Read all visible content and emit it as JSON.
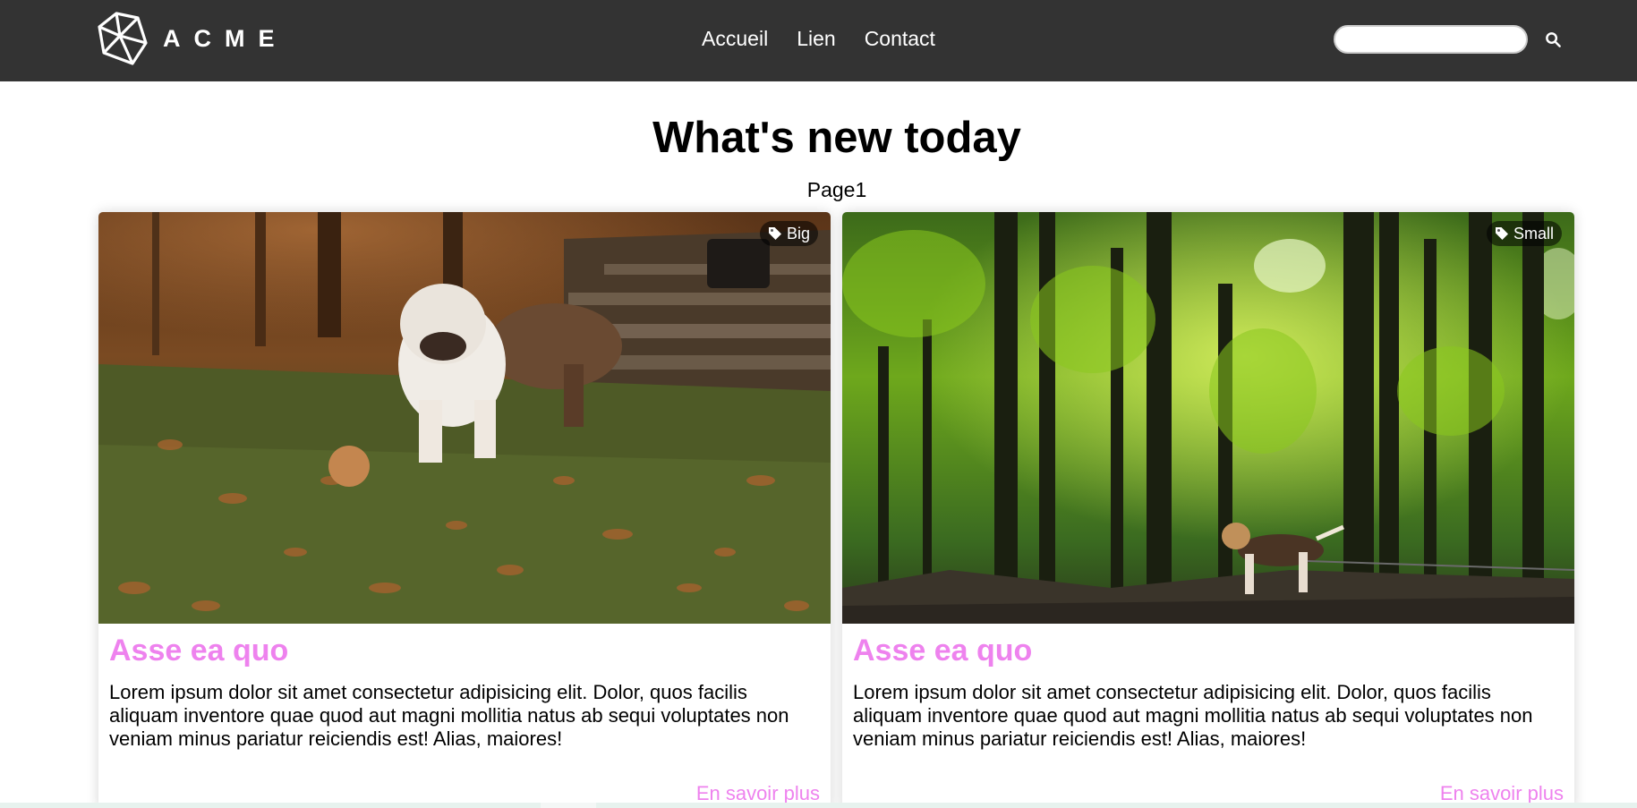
{
  "brand": {
    "name": "ACME",
    "logo_icon": "polyhedron-logo-icon"
  },
  "nav": {
    "items": [
      {
        "label": "Accueil"
      },
      {
        "label": "Lien"
      },
      {
        "label": "Contact"
      }
    ]
  },
  "search": {
    "value": "",
    "placeholder": "",
    "icon": "search-icon"
  },
  "main": {
    "title": "What's new today",
    "subtitle": "Page1"
  },
  "cards": [
    {
      "tag": "Big",
      "tag_icon": "tag-icon",
      "image": "bulldog-autumn-leaves-photo",
      "title": "Asse ea quo",
      "text": "Lorem ipsum dolor sit amet consectetur adipisicing elit. Dolor, quos facilis aliquam inventore quae quod aut magni mollitia natus ab sequi voluptates non veniam minus pariatur reiciendis est! Alias, maiores!",
      "link": "En savoir plus"
    },
    {
      "tag": "Small",
      "tag_icon": "tag-icon",
      "image": "beagle-forest-photo",
      "title": "Asse ea quo",
      "text": "Lorem ipsum dolor sit amet consectetur adipisicing elit. Dolor, quos facilis aliquam inventore quae quod aut magni mollitia natus ab sequi voluptates non veniam minus pariatur reiciendis est! Alias, maiores!",
      "link": "En savoir plus"
    }
  ],
  "colors": {
    "header_bg": "#333333",
    "accent_pink": "#ee82ee",
    "text": "#000000",
    "background": "#ffffff"
  }
}
